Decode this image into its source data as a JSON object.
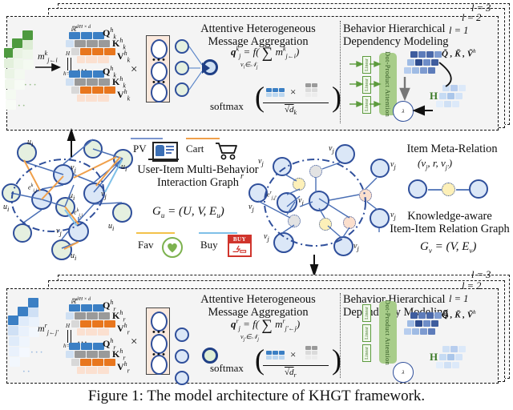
{
  "figure": {
    "caption": "Figure 1: The model architecture of KHGT framework.",
    "layer_labels": [
      "l = 3",
      "l = 2",
      "l = 1"
    ]
  },
  "top_panel": {
    "message_symbol": "m",
    "message_sub": "j←i",
    "message_sup": "k",
    "concat_top": "H",
    "concat_bottom": "h=1",
    "dim_label": "ℝ",
    "dim_sup": "d⁄H × d",
    "ellipsis": "…",
    "times": "×",
    "qkv": [
      {
        "q": "Q",
        "k": "K",
        "v": "V",
        "sub": "k",
        "sup": "h"
      },
      {
        "q": "Q",
        "k": "K",
        "v": "V",
        "sub": "k",
        "sup": "h"
      }
    ],
    "aggregation_title_line1": "Attentive Heterogeneous",
    "aggregation_title_line2": "Message Aggregation",
    "formula_q": "q",
    "formula_q_sub": "j",
    "formula_q_sup": "k",
    "formula_eq": "= f(",
    "formula_sum": "∑",
    "formula_sum_sub": "v",
    "formula_sum_sub2": "i",
    "formula_sum_in": "∈𝒩",
    "formula_sum_sub3": "j",
    "formula_msg": "m",
    "formula_msg_sub": "j←i",
    "formula_msg_sup": "k",
    "formula_close": ")",
    "softmax": "softmax",
    "denominator": "√d",
    "denominator_sub": "k",
    "hier_title_line1": "Behavior Hierarchical",
    "hier_title_line2": "Dependency Modeling",
    "linear_label": "Linear",
    "attention_label": "Dot-Product Attention",
    "qkv_tilde": "Q̃ , K̃ , Ṽ",
    "qkv_tilde_sup": "h",
    "h_label": "H",
    "lambda_label": "λ"
  },
  "bottom_panel": {
    "message_symbol": "m",
    "message_sub": "j←j′",
    "message_sup": "r",
    "concat_top": "H",
    "concat_bottom": "h=1",
    "dim_label": "ℝ",
    "dim_sup": "d⁄H × d",
    "ellipsis": "…",
    "times": "×",
    "qkv": [
      {
        "q": "Q",
        "k": "K",
        "v": "V",
        "sub": "r",
        "sup": "h"
      },
      {
        "q": "Q",
        "k": "K",
        "v": "V",
        "sub": "r",
        "sup": "h"
      }
    ],
    "aggregation_title_line1": "Attentive Heterogeneous",
    "aggregation_title_line2": "Message Aggregation",
    "formula_q": "q",
    "formula_q_sub": "j",
    "formula_q_sup": "r",
    "formula_eq": "= f(",
    "formula_sum": "∑",
    "formula_sum_sub": "v",
    "formula_sum_sub2": "j′",
    "formula_sum_in": "∈𝒩",
    "formula_sum_sub3": "j",
    "formula_msg": "m",
    "formula_msg_sub": "j′←j",
    "formula_msg_sup": "r",
    "formula_close": ")",
    "softmax": "softmax",
    "denominator": "√d",
    "denominator_sub": "r",
    "hier_title_line1": "Behavior Hierarchical",
    "hier_title_line2": "Dependency Modeling",
    "linear_label": "Linear",
    "attention_label": "Dot-Product Attention",
    "qkv_tilde": "Q̃ , K̃ , Ṽ",
    "qkv_tilde_sup": "h",
    "h_label": "H",
    "lambda_label": "λ"
  },
  "user_item_graph": {
    "title_line1": "User-Item Multi-Behavior",
    "title_line2": "Interaction Graph",
    "notation": "G  = (U, V, E )",
    "notation_sub1": "u",
    "notation_sub2": "u",
    "user_label": "u",
    "user_sub": "i",
    "item_label": "v",
    "item_sub": "j",
    "edge_label": "e",
    "edge_sub": "i,j",
    "edge_sup": "k",
    "behaviors": [
      {
        "name": "PV",
        "color": "#7b96cf",
        "icon": "page-view-icon"
      },
      {
        "name": "Cart",
        "color": "#f0a04b",
        "icon": "cart-icon"
      },
      {
        "name": "Fav",
        "color": "#f3c24a",
        "icon": "heart-icon"
      },
      {
        "name": "Buy",
        "color": "#7fc0e8",
        "icon": "buy-icon"
      }
    ]
  },
  "item_item_graph": {
    "meta_title": "Item Meta-Relation",
    "meta_tuple": "(v , r, v  )",
    "meta_sub1": "j",
    "meta_sub2": "j′",
    "title_line1": "Knowledge-aware",
    "title_line2": "Item-Item Relation Graph",
    "notation": "G  = (V, E )",
    "notation_sub1": "v",
    "notation_sub2": "v",
    "item_label": "v",
    "item_sub": "j",
    "relation_label": "r",
    "edge_label": "e",
    "edge_sub": "j,j′",
    "edge_sup": "r"
  },
  "colors": {
    "node_border": "#2f4f9b",
    "user_fill": "#e5f0e0",
    "item_fill": "#dbe7f7",
    "green_dark": "#4e9a3f",
    "green_light": "#e3f0dc",
    "blue_dark": "#3b7fc4",
    "blue_light": "#dbe8f7",
    "orange": "#e8761e",
    "gray": "#9a9a9a",
    "dot_attn": "#a8cd8a",
    "panel_bg": "#f4f4f4"
  }
}
